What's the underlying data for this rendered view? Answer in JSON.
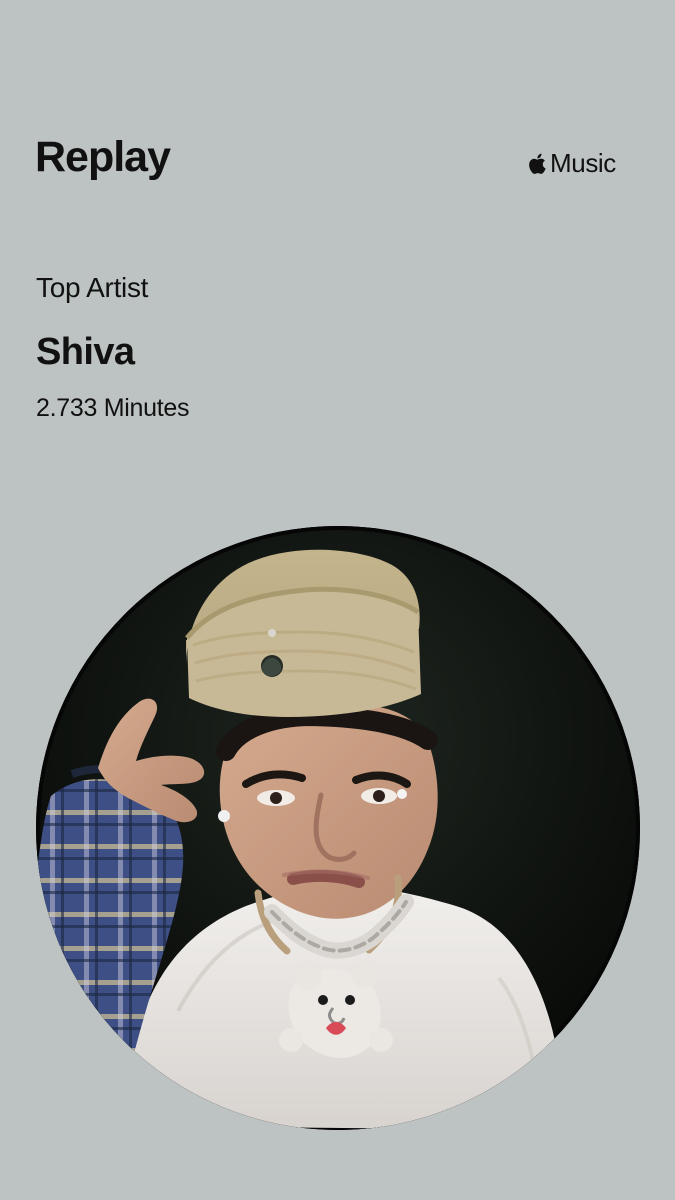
{
  "header": {
    "title": "Replay",
    "service_name": "Music",
    "service_logo_icon": "apple-logo-icon"
  },
  "stat": {
    "label": "Top Artist",
    "artist": "Shiva",
    "minutes": "2.733 Minutes"
  },
  "media": {
    "artist_photo_icon": "artist-portrait-image"
  },
  "colors": {
    "background": "#bdc3c2",
    "text": "#111111",
    "photo_background": "#0f120f"
  }
}
